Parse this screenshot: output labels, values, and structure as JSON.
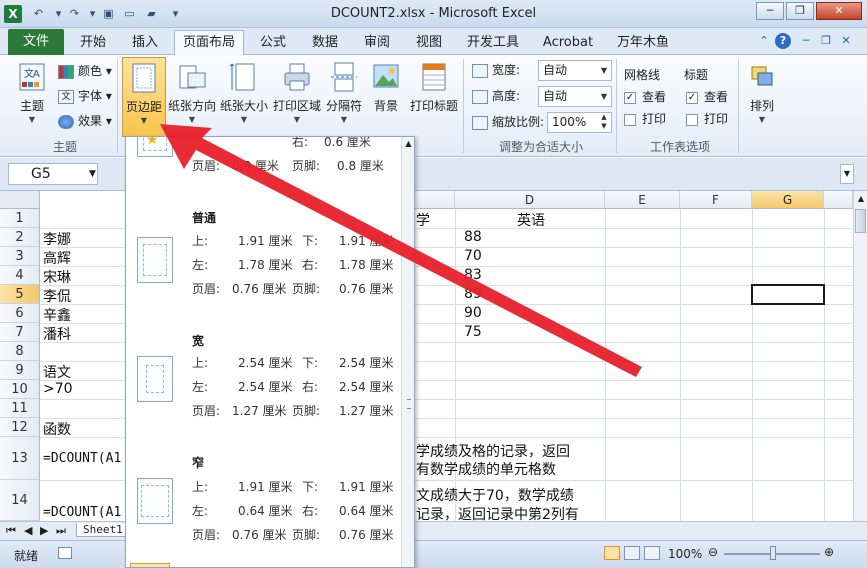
{
  "window": {
    "title": "DCOUNT2.xlsx - Microsoft Excel",
    "app_icon": "X",
    "controls": {
      "minimize": "─",
      "restore": "❐",
      "close": "✕"
    }
  },
  "tabs": [
    "文件",
    "开始",
    "插入",
    "页面布局",
    "公式",
    "数据",
    "审阅",
    "视图",
    "开发工具",
    "Acrobat",
    "万年木鱼"
  ],
  "active_tab": "页面布局",
  "ribbon": {
    "theme_group": {
      "label": "主题",
      "themes_button": "主题",
      "colors": "颜色",
      "fonts": "字体",
      "effects": "效果"
    },
    "page_setup": {
      "margins": "页边距",
      "orientation": "纸张方向",
      "size": "纸张大小",
      "print_area": "打印区域",
      "breaks": "分隔符",
      "background": "背景",
      "print_titles": "打印标题"
    },
    "scale_group": {
      "label": "调整为合适大小",
      "width_label": "宽度:",
      "width_value": "自动",
      "height_label": "高度:",
      "height_value": "自动",
      "scale_label": "缩放比例:",
      "scale_value": "100%"
    },
    "sheet_options": {
      "label": "工作表选项",
      "gridlines": "网格线",
      "headings": "标题",
      "view": "查看",
      "print": "打印"
    },
    "arrange": {
      "label": "排列"
    }
  },
  "formula_bar": {
    "name_box": "G5"
  },
  "grid": {
    "columns": [
      "D",
      "E",
      "F",
      "G"
    ],
    "selected_column": "G",
    "rows": [
      "1",
      "2",
      "3",
      "4",
      "5",
      "6",
      "7",
      "8",
      "9",
      "10",
      "11",
      "12",
      "13",
      "14"
    ],
    "selected_row": "5",
    "col_a": [
      "",
      "李娜",
      "高辉",
      "宋琳",
      "李侃",
      "辛鑫",
      "潘科",
      "",
      "语文",
      ">70",
      "",
      "函数",
      "=DCOUNT(A1",
      "=DCOUNT(A1"
    ],
    "col_c_header": "学",
    "col_d": [
      "英语",
      "88",
      "70",
      "83",
      "89",
      "90",
      "75"
    ],
    "note13_line1": "学成绩及格的记录，返回",
    "note13_line2": "有数学成绩的单元格数",
    "note14_line1": "文成绩大于70，数学成绩",
    "note14_line2": "记录，返回记录中第2列有"
  },
  "sheet_tab": "Sheet1",
  "status": {
    "ready": "就绪",
    "zoom": "100%"
  },
  "margins_menu": {
    "partial_top": {
      "row1": [
        "右:",
        "0.6 厘米"
      ],
      "row2": [
        "页眉:",
        "0.8 厘米",
        "页脚:",
        "0.8 厘米"
      ]
    },
    "options": [
      {
        "name": "普通",
        "top": "1.91 厘米",
        "bottom": "1.91 厘米",
        "left": "1.78 厘米",
        "right": "1.78 厘米",
        "header": "0.76 厘米",
        "footer": "0.76 厘米"
      },
      {
        "name": "宽",
        "top": "2.54 厘米",
        "bottom": "2.54 厘米",
        "left": "2.54 厘米",
        "right": "2.54 厘米",
        "header": "1.27 厘米",
        "footer": "1.27 厘米"
      },
      {
        "name": "窄",
        "top": "1.91 厘米",
        "bottom": "1.91 厘米",
        "left": "0.64 厘米",
        "right": "0.64 厘米",
        "header": "0.76 厘米",
        "footer": "0.76 厘米"
      }
    ],
    "labels": {
      "top": "上:",
      "bottom": "下:",
      "left": "左:",
      "right": "右:",
      "header": "页眉:",
      "footer": "页脚:"
    }
  },
  "colors": {
    "excel_green": "#2b7a3a",
    "arrow_red": "#e8202a",
    "pressed": "#f7c54c"
  }
}
